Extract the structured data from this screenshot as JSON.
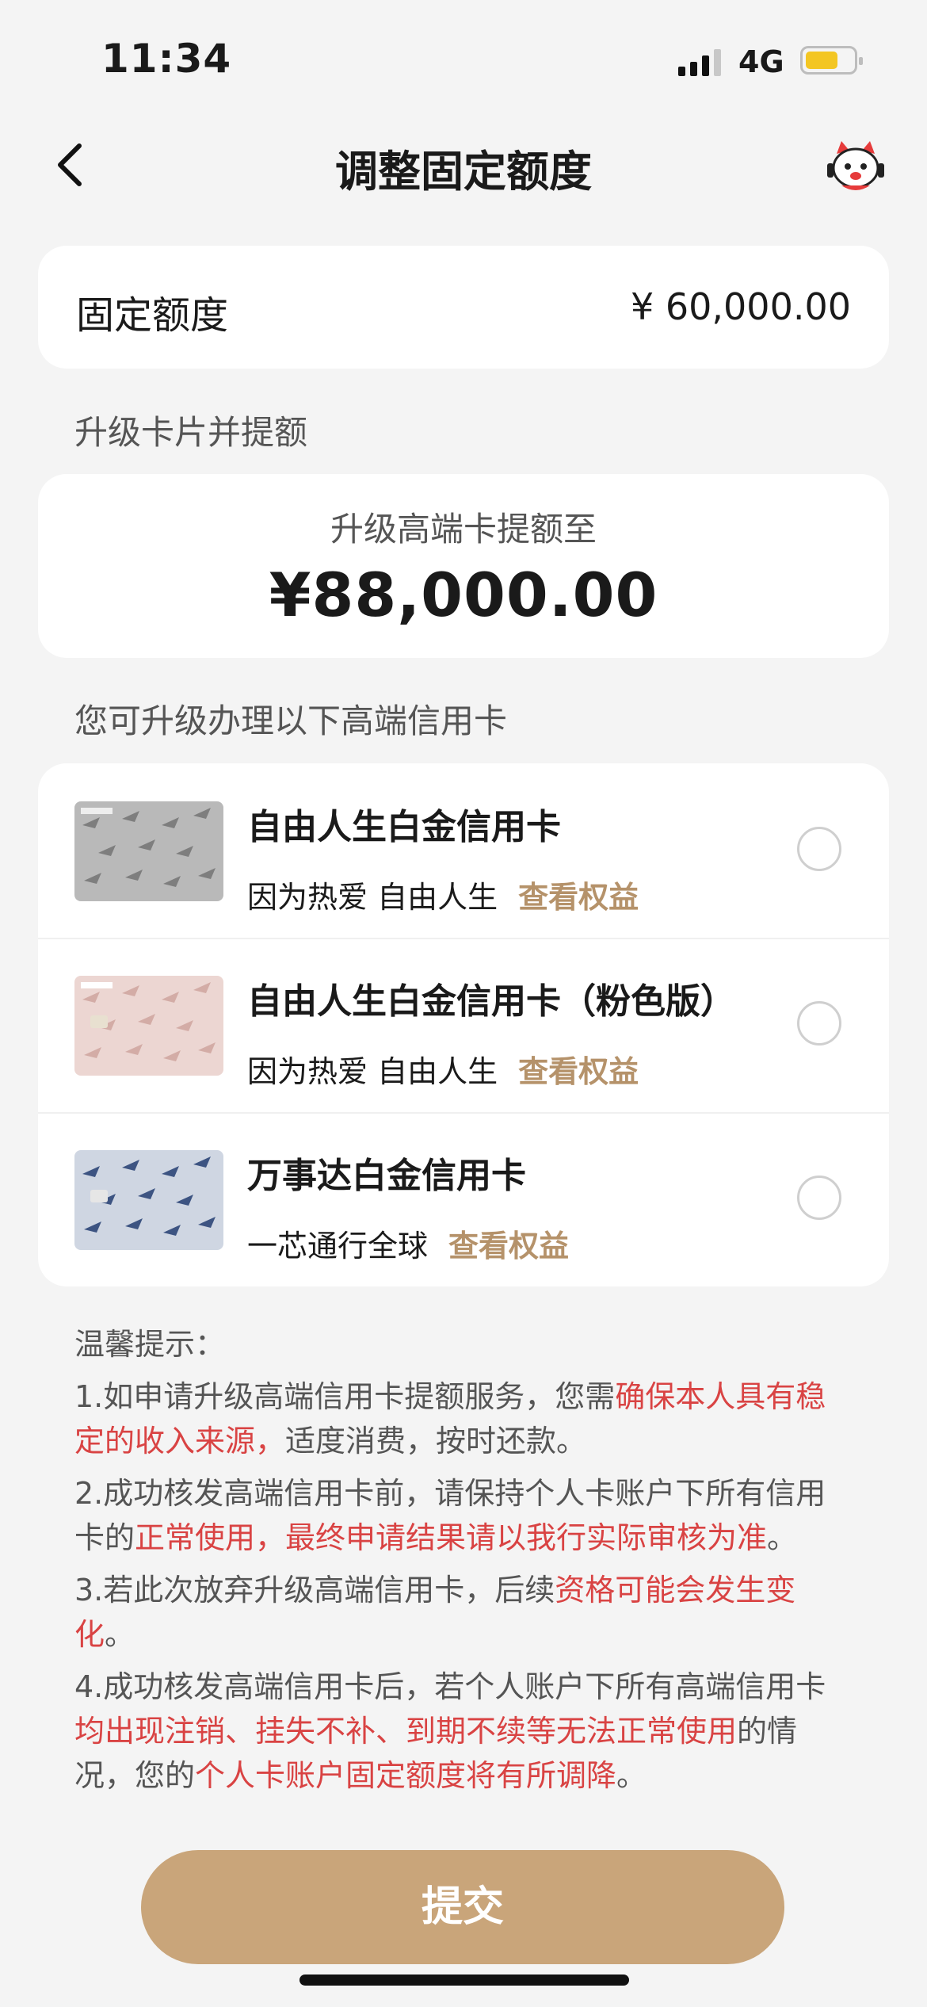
{
  "status_bar": {
    "time": "11:34",
    "network": "4G"
  },
  "nav": {
    "title": "调整固定额度"
  },
  "fixed_limit": {
    "label": "固定额度",
    "amount": "¥ 60,000.00"
  },
  "upgrade_section": {
    "label": "升级卡片并提额",
    "subtitle": "升级高端卡提额至",
    "amount": "¥88,000.00"
  },
  "cards_section": {
    "label": "您可升级办理以下高端信用卡",
    "cards": [
      {
        "name": "自由人生白金信用卡",
        "slogan": "因为热爱 自由人生",
        "benefit": "查看权益",
        "selected": false
      },
      {
        "name": "自由人生白金信用卡（粉色版）",
        "slogan": "因为热爱 自由人生",
        "benefit": "查看权益",
        "selected": false
      },
      {
        "name": "万事达白金信用卡",
        "slogan": "一芯通行全球",
        "benefit": "查看权益",
        "selected": false
      }
    ]
  },
  "tips": {
    "title": "温馨提示：",
    "items": [
      {
        "n": "1.如申请升级高端信用卡提额服务，您需",
        "h": "确保本人具有稳定的收入来源，",
        "t": "适度消费，按时还款。"
      },
      {
        "n": "2.成功核发高端信用卡前，请保持个人卡账户下所有信用卡的",
        "h": "正常使用，最终申请结果请以我行实际审核为准",
        "t": "。"
      },
      {
        "n": "3.若此次放弃升级高端信用卡，后续",
        "h": "资格可能会发生变化",
        "t": "。"
      },
      {
        "n": "4.成功核发高端信用卡后，若个人账户下所有高端信用卡",
        "h": "均出现注销、挂失不补、到期不续等无法正常使用",
        "m": "的情况，您的",
        "h2": "个人卡账户固定额度将有所调降",
        "t": "。"
      }
    ]
  },
  "submit": {
    "label": "提交"
  },
  "colors": {
    "accent": "#c9a57a",
    "benefit": "#b5926a",
    "highlight": "#d94343",
    "background": "#f4f4f4"
  }
}
